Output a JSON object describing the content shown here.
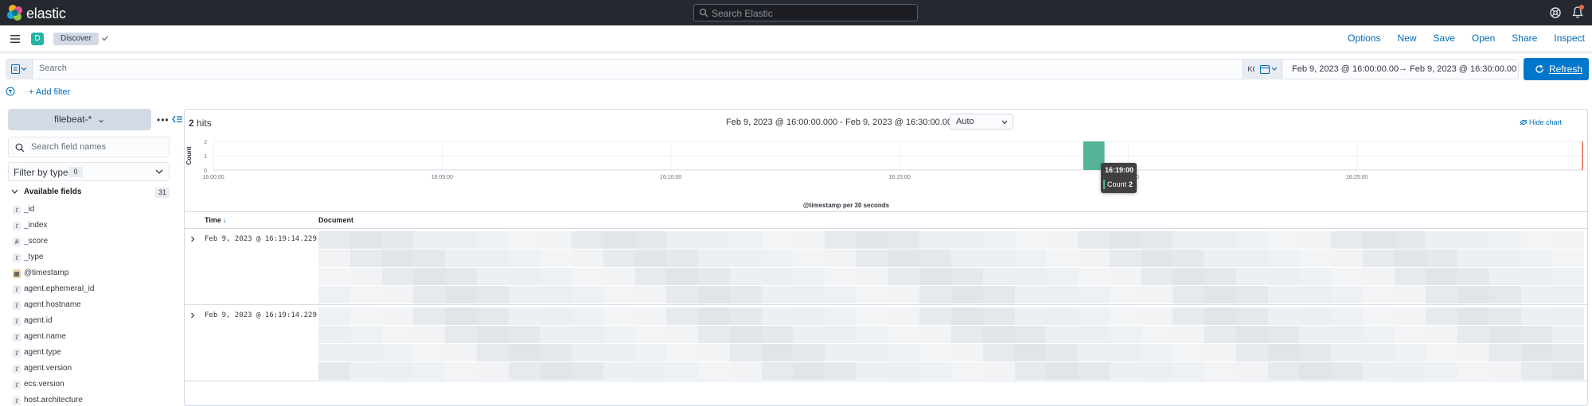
{
  "header": {
    "brand": "elastic",
    "search_placeholder": "Search Elastic"
  },
  "subheader": {
    "space_initial": "D",
    "breadcrumb": "Discover",
    "links": [
      "Options",
      "New",
      "Save",
      "Open",
      "Share",
      "Inspect"
    ]
  },
  "querybar": {
    "placeholder": "Search",
    "language": "KQL",
    "start": "Feb 9, 2023 @ 16:00:00.00",
    "arrow": "→",
    "end": "Feb 9, 2023 @ 16:30:00.00",
    "refresh_label": "Refresh"
  },
  "filters": {
    "add_filter": "+ Add filter"
  },
  "sidebar": {
    "index_pattern": "filebeat-*",
    "more": "•••",
    "field_search_placeholder": "Search field names",
    "filter_by_type": "Filter by type",
    "filter_count": "0",
    "available_label": "Available fields",
    "available_count": "31",
    "fields": [
      {
        "type": "t",
        "name": "_id"
      },
      {
        "type": "t",
        "name": "_index"
      },
      {
        "type": "#",
        "name": "_score"
      },
      {
        "type": "t",
        "name": "_type"
      },
      {
        "type": "date",
        "name": "@timestamp"
      },
      {
        "type": "t",
        "name": "agent.ephemeral_id"
      },
      {
        "type": "t",
        "name": "agent.hostname"
      },
      {
        "type": "t",
        "name": "agent.id"
      },
      {
        "type": "t",
        "name": "agent.name"
      },
      {
        "type": "t",
        "name": "agent.type"
      },
      {
        "type": "t",
        "name": "agent.version"
      },
      {
        "type": "t",
        "name": "ecs.version"
      },
      {
        "type": "t",
        "name": "host.architecture"
      }
    ]
  },
  "main": {
    "hits_count": "2",
    "hits_label": "hits",
    "range": "Feb 9, 2023 @ 16:00:00.000 - Feb 9, 2023 @ 16:30:00.000",
    "interval": "Auto",
    "hide_chart": "Hide chart",
    "table_headers": {
      "time": "Time",
      "document": "Document"
    },
    "rows": [
      {
        "timestamp": "Feb 9, 2023 @ 16:19:14.229"
      },
      {
        "timestamp": "Feb 9, 2023 @ 16:19:14.229"
      }
    ],
    "tooltip": {
      "time": "16:19:00",
      "label": "Count",
      "value": "2"
    }
  },
  "colors": {
    "bar": "#54b399",
    "now_marker": "#e7664c",
    "accent": "#0077cc"
  },
  "chart_data": {
    "type": "bar",
    "x_ticks": [
      "16:00:00",
      "16:05:00",
      "16:10:00",
      "16:15:00",
      "16:20:00",
      "16:25:00"
    ],
    "x": [
      "16:19:00"
    ],
    "values": [
      2
    ],
    "xlabel": "@timestamp per 30 seconds",
    "ylabel": "Count",
    "y_ticks": [
      "2",
      "1",
      "0"
    ],
    "ylim": [
      0,
      2
    ],
    "grid": true
  }
}
